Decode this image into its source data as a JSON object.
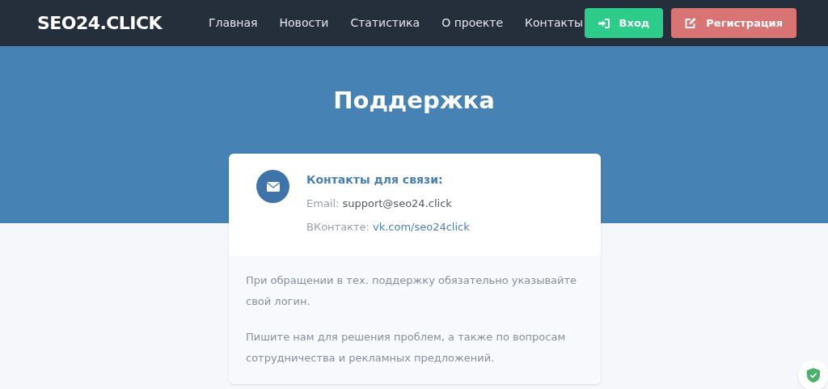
{
  "header": {
    "logo": "SEO24.CLICK",
    "nav": [
      {
        "label": "Главная"
      },
      {
        "label": "Новости"
      },
      {
        "label": "Статистика"
      },
      {
        "label": "О проекте"
      },
      {
        "label": "Контакты"
      }
    ],
    "buttons": [
      {
        "kind": "login",
        "label": "Вход"
      },
      {
        "kind": "register",
        "label": "Регистрация"
      }
    ]
  },
  "hero": {
    "title": "Поддержка"
  },
  "card": {
    "heading": "Контакты для связи:",
    "contacts": [
      {
        "label": "Email:",
        "value": "support@seo24.click",
        "kind": "text"
      },
      {
        "label": "ВКонтакте:",
        "value": "vk.com/seo24click",
        "kind": "link"
      }
    ],
    "notes": [
      "При обращении в тех. поддержку обязательно указывайте свой логин.",
      "Пишите нам для решения проблем, а также по вопросам сотрудничества и рекламных предложений."
    ]
  }
}
